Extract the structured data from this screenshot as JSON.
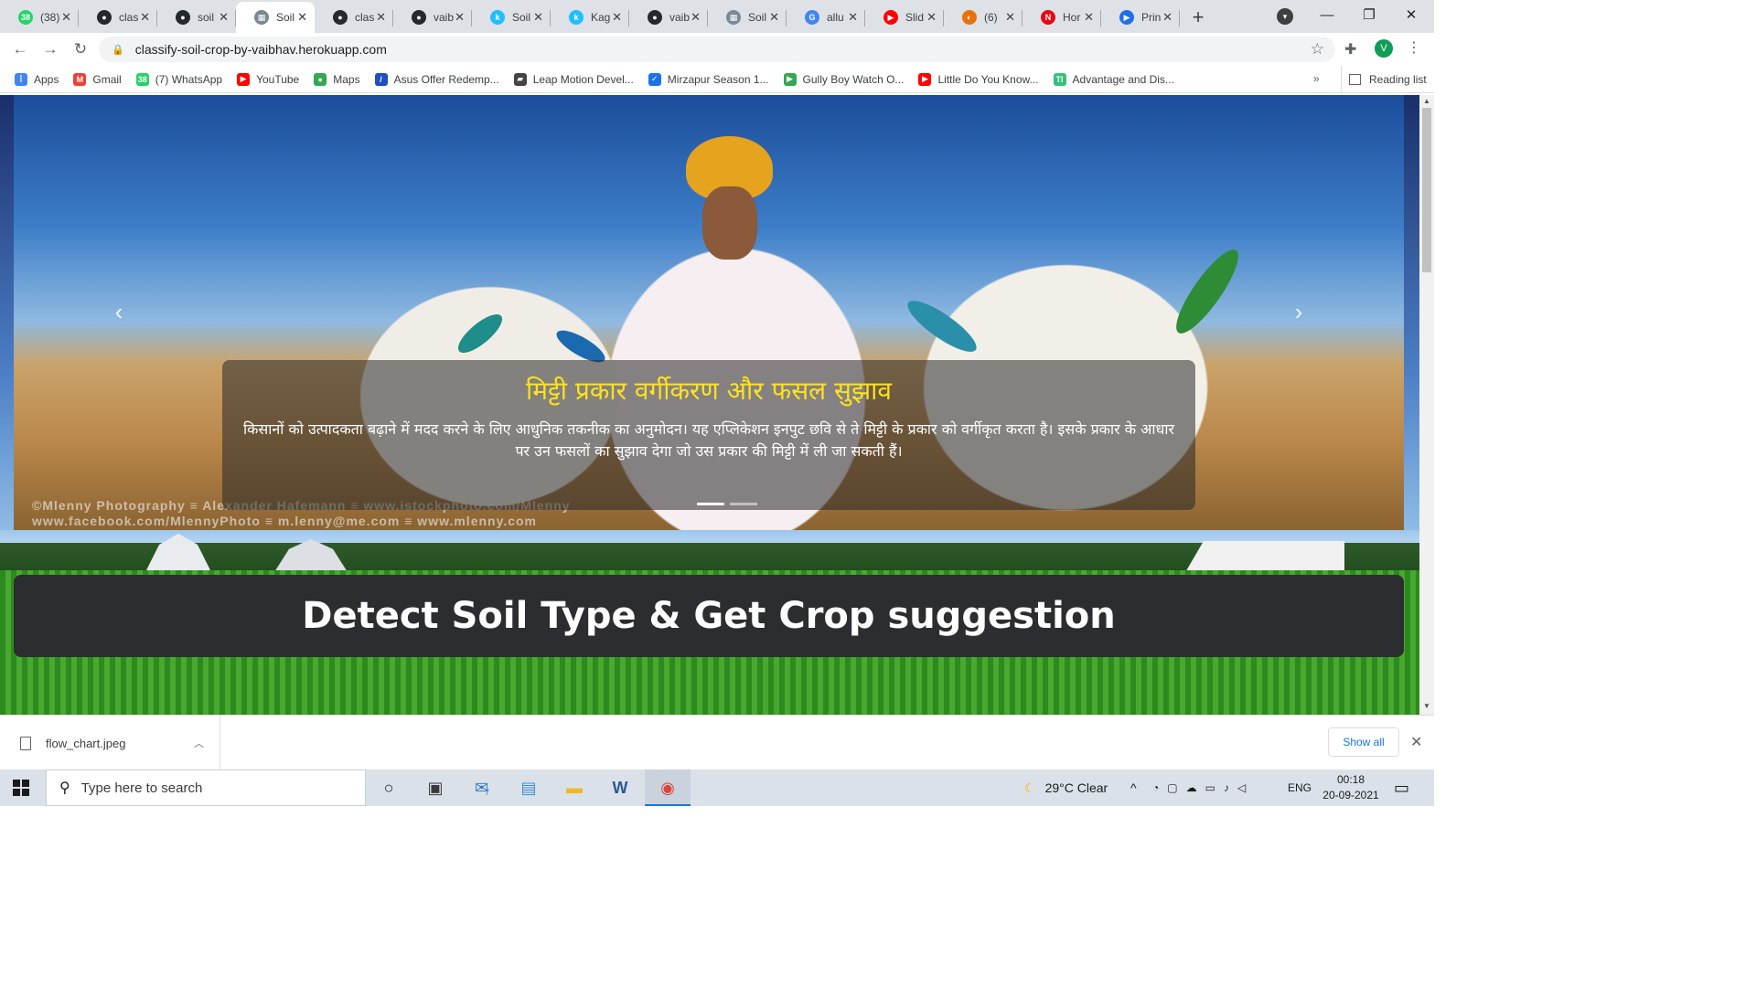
{
  "browser": {
    "tabs": [
      {
        "title": "(38)",
        "icon": "whatsapp-icon",
        "icon_color": "#25d366",
        "glyph": "38"
      },
      {
        "title": "clas",
        "icon": "github-icon",
        "icon_color": "#24292e",
        "glyph": "●"
      },
      {
        "title": "soil",
        "icon": "github-icon",
        "icon_color": "#24292e",
        "glyph": "●"
      },
      {
        "title": "Soil",
        "icon": "soil-site-icon",
        "icon_color": "#7a8a94",
        "glyph": "▦",
        "active": true
      },
      {
        "title": "clas",
        "icon": "github-icon",
        "icon_color": "#24292e",
        "glyph": "●"
      },
      {
        "title": "vaib",
        "icon": "github-icon",
        "icon_color": "#24292e",
        "glyph": "●"
      },
      {
        "title": "Soil",
        "icon": "kaggle-icon",
        "icon_color": "#20beff",
        "glyph": "k"
      },
      {
        "title": "Kag",
        "icon": "kaggle-icon",
        "icon_color": "#20beff",
        "glyph": "k"
      },
      {
        "title": "vaib",
        "icon": "github-icon",
        "icon_color": "#24292e",
        "glyph": "●"
      },
      {
        "title": "Soil",
        "icon": "soil-site-icon",
        "icon_color": "#7a8a94",
        "glyph": "▦"
      },
      {
        "title": "allu",
        "icon": "google-icon",
        "icon_color": "#4285f4",
        "glyph": "G"
      },
      {
        "title": "Slid",
        "icon": "youtube-icon",
        "icon_color": "#ff0000",
        "glyph": "▶"
      },
      {
        "title": "(6)",
        "icon": "loading-icon",
        "icon_color": "#e8710a",
        "glyph": "◐"
      },
      {
        "title": "Hor",
        "icon": "netflix-icon",
        "icon_color": "#e50914",
        "glyph": "N"
      },
      {
        "title": "Prin",
        "icon": "prime-video-icon",
        "icon_color": "#1f6feb",
        "glyph": "▶"
      }
    ],
    "new_tab": "+",
    "close_glyph": "✕",
    "url": "classify-soil-crop-by-vaibhav.herokuapp.com",
    "profile_initial": "V",
    "profile_color": "#0f9d58",
    "bookmarks": [
      {
        "label": "Apps",
        "icon": "apps-grid-icon",
        "color": "#4285f4",
        "glyph": "⋮"
      },
      {
        "label": "Gmail",
        "icon": "gmail-icon",
        "color": "#ea4335",
        "glyph": "M"
      },
      {
        "label": "(7) WhatsApp",
        "icon": "whatsapp-icon",
        "color": "#25d366",
        "glyph": "38"
      },
      {
        "label": "YouTube",
        "icon": "youtube-icon",
        "color": "#ff0000",
        "glyph": "▶"
      },
      {
        "label": "Maps",
        "icon": "maps-pin-icon",
        "color": "#34a853",
        "glyph": "●"
      },
      {
        "label": "Asus Offer Redemp...",
        "icon": "asus-icon",
        "color": "#1d4fbf",
        "glyph": "/"
      },
      {
        "label": "Leap Motion Devel...",
        "icon": "leap-motion-icon",
        "color": "#444444",
        "glyph": "▰"
      },
      {
        "label": "Mirzapur Season 1...",
        "icon": "check-badge-icon",
        "color": "#1a73e8",
        "glyph": "✓"
      },
      {
        "label": "Gully Boy Watch O...",
        "icon": "play-circle-icon",
        "color": "#34a853",
        "glyph": "▶"
      },
      {
        "label": "Little Do You Know...",
        "icon": "youtube-icon",
        "color": "#ff0000",
        "glyph": "▶"
      },
      {
        "label": "Advantage and Dis...",
        "icon": "ti-icon",
        "color": "#36c07a",
        "glyph": "TI"
      }
    ],
    "bookmarks_more": "»",
    "reading_list": "Reading list"
  },
  "page": {
    "caption_title": "मिट्टी प्रकार वर्गीकरण और फसल सुझाव",
    "caption_text": "किसानों को उत्पादकता बढ़ाने में मदद करने के लिए आधुनिक तकनीक का अनुमोदन। यह एप्लिकेशन इनपुट छवि से ते मिट्टी के प्रकार को वर्गीकृत करता है। इसके प्रकार के आधार पर उन फसलों का सुझाव देगा जो उस प्रकार की मिट्टी में ली जा सकती हैं।",
    "image_credit_line1": "©Mlenny Photography ≡ Alexander Hafemann ≡ www.istockphoto.com/Mlenny",
    "image_credit_line2": "www.facebook.com/MlennyPhoto ≡ m.lenny@me.com ≡ www.mlenny.com",
    "prev_glyph": "‹",
    "next_glyph": "›",
    "indicator_count": 2,
    "active_indicator": 1,
    "hero_heading": "Detect Soil Type & Get Crop suggestion",
    "caption_title_color": "#ffe21a"
  },
  "downloads": {
    "file_name": "flow_chart.jpeg",
    "show_all": "Show all"
  },
  "taskbar": {
    "search_placeholder": "Type here to search",
    "weather": "29°C  Clear",
    "language": "ENG",
    "time": "00:18",
    "date": "20-09-2021",
    "mail_badge": "7"
  }
}
